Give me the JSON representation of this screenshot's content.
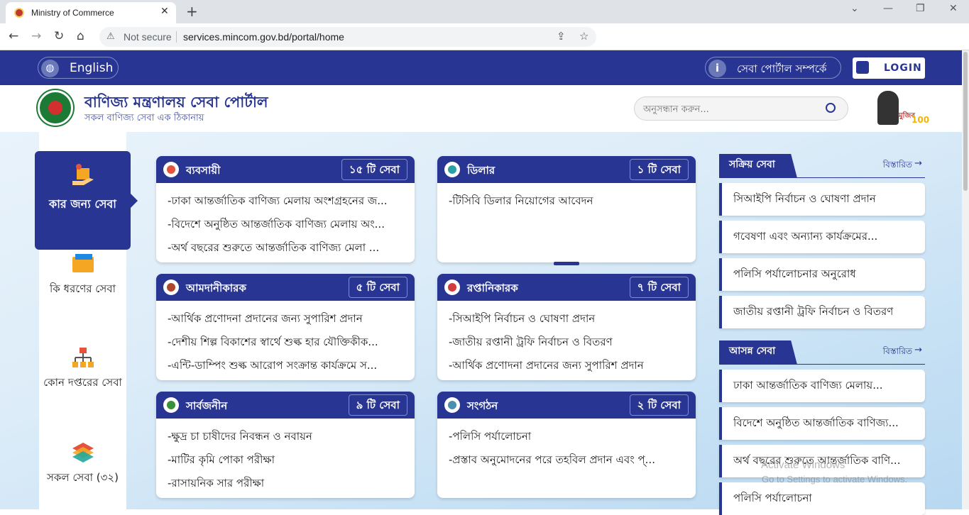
{
  "browser": {
    "tab_title": "Ministry of Commerce",
    "not_secure": "Not secure",
    "url": "services.mincom.gov.bd/portal/home"
  },
  "topbar": {
    "language_label": "English",
    "about_label": "সেবা পোর্টাল সম্পর্কে",
    "login_label": "LOGIN"
  },
  "header": {
    "title": "বাণিজ্য মন্ত্রণালয় সেবা পোর্টাল",
    "subtitle": "সকল বাণিজ্য সেবা এক ঠিকানায়",
    "search_placeholder": "অনুসন্ধান করুন...",
    "mujib_text": "মুজিব",
    "mujib_number": "100"
  },
  "sidebar": {
    "items": [
      {
        "label": "কার জন্য সেবা",
        "icon": "hand-box-icon"
      },
      {
        "label": "কি ধরণের সেবা",
        "icon": "folder-icon"
      },
      {
        "label": "কোন দপ্তরের সেবা",
        "icon": "org-chart-icon"
      },
      {
        "label": "সকল সেবা (৩২)",
        "icon": "stack-icon"
      }
    ]
  },
  "cards": [
    {
      "title": "ব্যবসায়ী",
      "count": "১৫ টি সেবা",
      "icon": "businessman-icon",
      "icon_color": "#e5533d",
      "items": [
        "-ঢাকা আন্তর্জাতিক বাণিজ্য মেলায় অংশগ্রহনের জ...",
        "-বিদেশে অনুষ্ঠিত আন্তর্জাতিক বাণিজ্য মেলায় অং...",
        "-অর্থ বছরের শুরুতে আন্তর্জাতিক বাণিজ্য মেলা ..."
      ]
    },
    {
      "title": "ডিলার",
      "count": "১ টি সেবা",
      "icon": "dealer-icon",
      "icon_color": "#2aa0a4",
      "items": [
        "-টিসিবি ডিলার নিয়োগের আবেদন"
      ]
    },
    {
      "title": "আমদানীকারক",
      "count": "৫ টি সেবা",
      "icon": "importer-icon",
      "icon_color": "#b0472c",
      "items": [
        "-আর্থিক প্রণোদনা প্রদানের জন্য সুপারিশ প্রদান",
        "-দেশীয় শিল্প বিকাশের স্বার্থে শুল্ক হার যৌক্তিকীক...",
        "-এন্টি-ডাম্পিং শুল্ক আরোপ সংক্রান্ত কার্যক্রমে স..."
      ]
    },
    {
      "title": "রপ্তানিকারক",
      "count": "৭ টি সেবা",
      "icon": "exporter-icon",
      "icon_color": "#d23c3c",
      "items": [
        "-সিআইপি নির্বাচন ও ঘোষণা প্রদান",
        "-জাতীয় রপ্তানী ট্রফি নির্বাচন ও বিতরণ",
        "-আর্থিক প্রণোদনা প্রদানের জন্য সুপারিশ প্রদান"
      ]
    },
    {
      "title": "সার্বজনীন",
      "count": "৯ টি সেবা",
      "icon": "citizen-icon",
      "icon_color": "#3a8f3a",
      "items": [
        "-ক্ষুদ্র চা চাষীদের নিবন্ধন ও নবায়ন",
        "-মাটির কৃমি পোকা পরীক্ষা",
        "-রাসায়নিক সার পরীক্ষা"
      ]
    },
    {
      "title": "সংগঠন",
      "count": "২ টি সেবা",
      "icon": "organization-icon",
      "icon_color": "#4a8fb0",
      "items": [
        "-পলিসি পর্যালোচনা",
        "-প্রস্তাব অনুমোদনের পরে তহবিল প্রদান এবং প্..."
      ]
    }
  ],
  "active_services": {
    "title": "সক্রিয় সেবা",
    "more": "বিস্তারিত",
    "items": [
      "সিআইপি নির্বাচন ও ঘোষণা প্রদান",
      "গবেষণা এবং অন্যান্য কার্যক্রমের...",
      "পলিসি পর্যালোচনার অনুরোধ",
      "জাতীয় রপ্তানী ট্রফি নির্বাচন ও বিতরণ"
    ]
  },
  "upcoming_services": {
    "title": "আসন্ন সেবা",
    "more": "বিস্তারিত",
    "items": [
      "ঢাকা আন্তর্জাতিক বাণিজ্য মেলায়...",
      "বিদেশে অনুষ্ঠিত আন্তর্জাতিক বাণিজ্য...",
      "অর্থ বছরের শুরুতে আন্তর্জাতিক বাণি...",
      "পলিসি পর্যালোচনা"
    ]
  },
  "watermark": {
    "line1": "Activate Windows",
    "line2": "Go to Settings to activate Windows."
  }
}
